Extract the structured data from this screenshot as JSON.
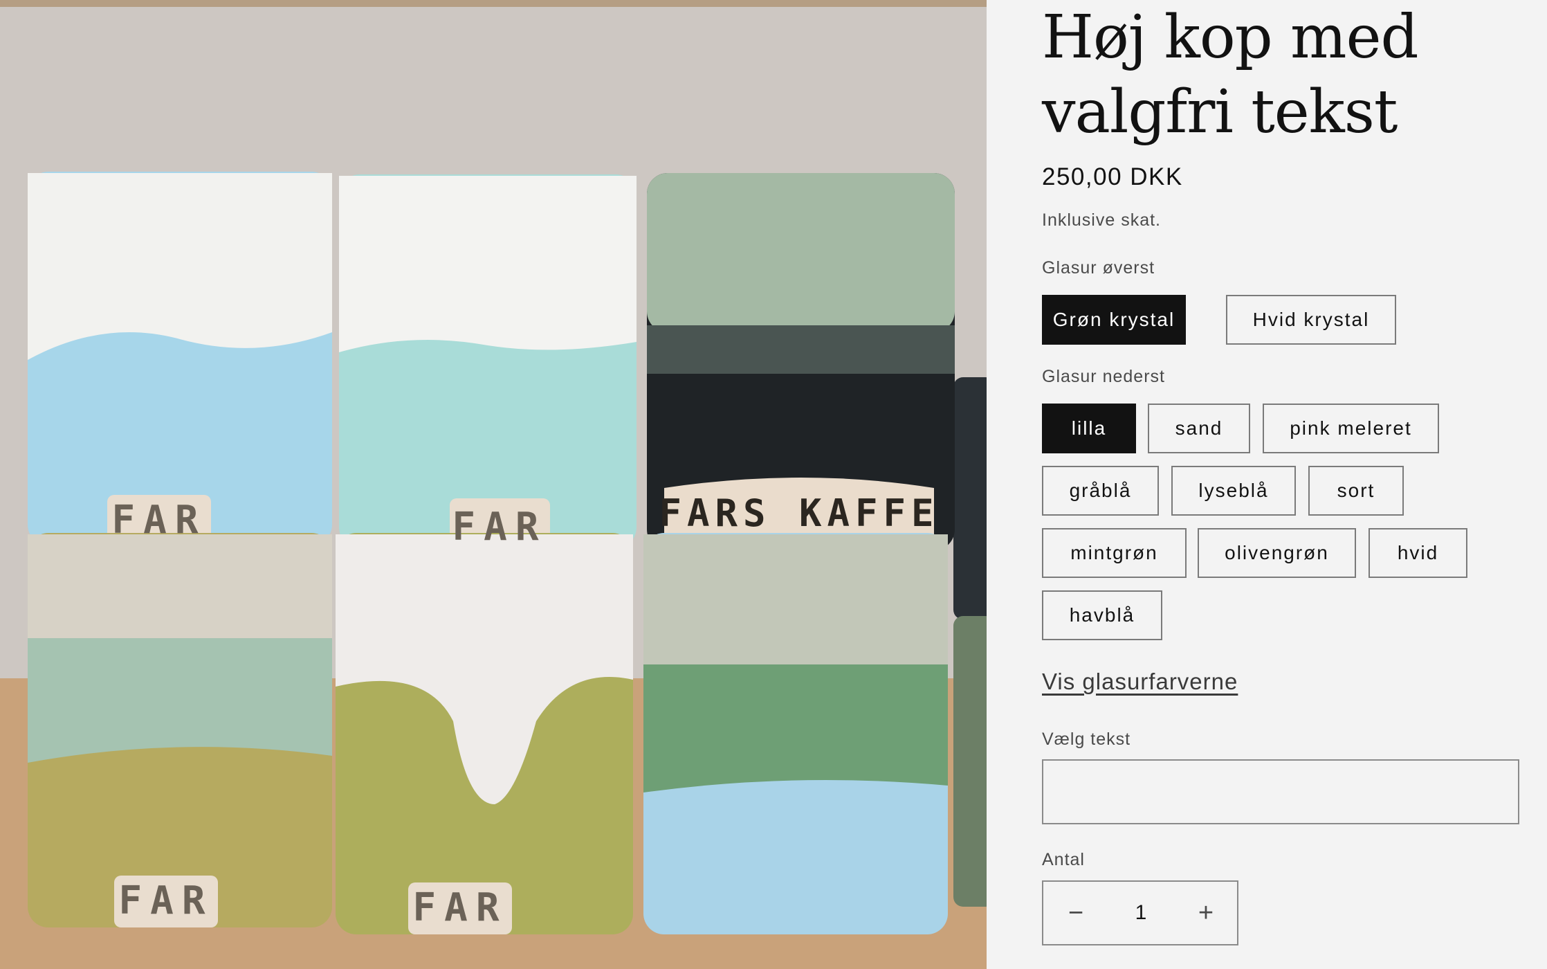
{
  "product": {
    "title_line1": "Høj kop med",
    "title_line2": "valgfri tekst",
    "price": "250,00 DKK",
    "tax_note": "Inklusive skat."
  },
  "image": {
    "alt": "Keramikkopper med stempel",
    "stamps": [
      "FAR",
      "FAR",
      "FARS KAFFE",
      "FAR",
      "FAR"
    ]
  },
  "glaze_top": {
    "label": "Glasur øverst",
    "options": [
      "Grøn krystal",
      "Hvid krystal"
    ],
    "selected": "Grøn krystal"
  },
  "glaze_bottom": {
    "label": "Glasur nederst",
    "options": [
      "lilla",
      "sand",
      "pink meleret",
      "gråblå",
      "lyseblå",
      "sort",
      "mintgrøn",
      "olivengrøn",
      "hvid",
      "havblå"
    ],
    "selected": "lilla"
  },
  "glaze_link": "Vis glasurfarverne",
  "custom_text": {
    "label": "Vælg tekst",
    "value": ""
  },
  "quantity": {
    "label": "Antal",
    "value": "1",
    "minus": "−",
    "plus": "+"
  },
  "colors": {
    "selected_bg": "#121212",
    "page_bg": "#f3f3f3"
  }
}
